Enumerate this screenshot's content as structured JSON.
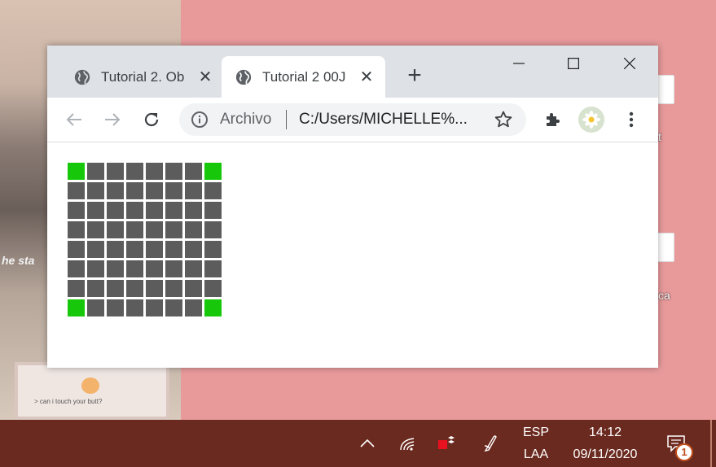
{
  "desktop": {
    "wallpaper_caption": "he sta",
    "wallpaper_card_text": "> can i touch your butt?",
    "icon_labels": [
      "t",
      "ca"
    ]
  },
  "browser": {
    "tabs": [
      {
        "title": "Tutorial 2. Ob",
        "icon": "globe-icon",
        "active": false
      },
      {
        "title": "Tutorial 2 00J",
        "icon": "globe-icon",
        "active": true
      }
    ],
    "new_tab_icon": "plus-icon",
    "window_controls": [
      "minimize-icon",
      "maximize-icon",
      "close-icon"
    ],
    "toolbar": {
      "back_icon": "arrow-left-icon",
      "forward_icon": "arrow-right-icon",
      "reload_icon": "reload-icon",
      "scheme_label": "Archivo",
      "url": "C:/Users/MICHELLE%...",
      "bookmark_icon": "star-icon",
      "extensions_icon": "puzzle-icon",
      "menu_icon": "more-vert-icon"
    },
    "grid": {
      "rows": 8,
      "cols": 8,
      "colors": {
        "default": "#5c5c5c",
        "corner": "#17c80a"
      },
      "highlighted_cells": [
        [
          0,
          0
        ],
        [
          0,
          7
        ],
        [
          7,
          0
        ],
        [
          7,
          7
        ]
      ]
    }
  },
  "taskbar": {
    "language_top": "ESP",
    "language_bottom": "LAA",
    "time": "14:12",
    "date": "09/11/2020",
    "notification_count": "1",
    "tray_icons": [
      "chevron-up-icon",
      "wifi-icon",
      "dropbox-icon",
      "pen-icon",
      "notification-icon"
    ]
  },
  "colors": {
    "desktop_bg": "#e89a9b",
    "taskbar_bg": "#6b2a1f",
    "titlebar_bg": "#dee1e6"
  }
}
